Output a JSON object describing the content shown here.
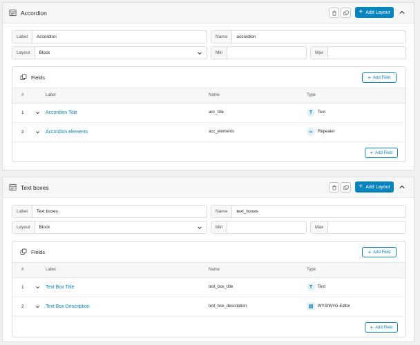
{
  "layouts": [
    {
      "title": "Accordion",
      "add_layout_label": "Add Layout",
      "label_field": {
        "label": "Label",
        "value": "Accordion"
      },
      "name_field": {
        "label": "Name",
        "value": "accordion"
      },
      "layout_field": {
        "label": "Layout",
        "value": "Block"
      },
      "min_field": {
        "label": "Min",
        "value": ""
      },
      "max_field": {
        "label": "Max",
        "value": ""
      },
      "fields_title": "Fields",
      "add_field_label": "Add Field",
      "columns": {
        "num": "#",
        "label": "Label",
        "name": "Name",
        "type": "Type"
      },
      "rows": [
        {
          "num": "1",
          "label": "Accordion Title",
          "name": "acc_title",
          "type": "Text",
          "type_icon": "text-type-icon",
          "badge": "T"
        },
        {
          "num": "2",
          "label": "Accordion elements",
          "name": "acc_elements",
          "type": "Repeater",
          "type_icon": "repeater-type-icon",
          "badge": "∞"
        }
      ]
    },
    {
      "title": "Text boxes",
      "add_layout_label": "Add Layout",
      "label_field": {
        "label": "Label",
        "value": "Text boxes"
      },
      "name_field": {
        "label": "Name",
        "value": "text_boxes"
      },
      "layout_field": {
        "label": "Layout",
        "value": "Block"
      },
      "min_field": {
        "label": "Min",
        "value": ""
      },
      "max_field": {
        "label": "Max",
        "value": ""
      },
      "fields_title": "Fields",
      "add_field_label": "Add Field",
      "columns": {
        "num": "#",
        "label": "Label",
        "name": "Name",
        "type": "Type"
      },
      "rows": [
        {
          "num": "1",
          "label": "Text Box Title",
          "name": "text_box_title",
          "type": "Text",
          "type_icon": "text-type-icon",
          "badge": "T"
        },
        {
          "num": "2",
          "label": "Text Box Description",
          "name": "text_box_description",
          "type": "WYSIWYG Editor",
          "type_icon": "wysiwyg-type-icon",
          "badge": "▤"
        }
      ]
    }
  ],
  "colors": {
    "accent": "#0783be",
    "border": "#dcdcde",
    "header_bg": "#f6f7f7",
    "page_bg": "#f0f0f1"
  }
}
